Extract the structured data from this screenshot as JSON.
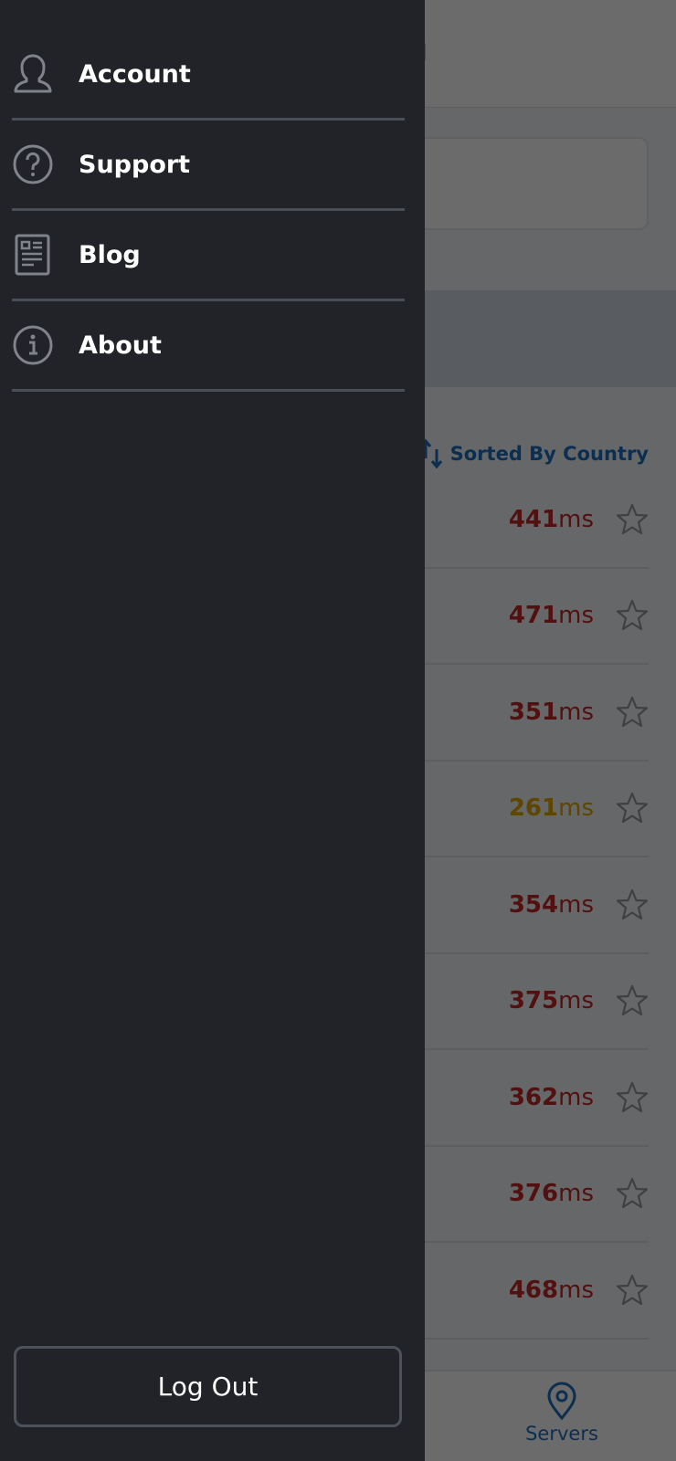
{
  "app": {
    "title_fragment": "n",
    "sort_label": "Sorted By Country",
    "servers": [
      {
        "latency": "441",
        "unit": "ms",
        "status": "red"
      },
      {
        "latency": "471",
        "unit": "ms",
        "status": "red"
      },
      {
        "latency": "351",
        "unit": "ms",
        "status": "red"
      },
      {
        "latency": "261",
        "unit": "ms",
        "status": "amber"
      },
      {
        "latency": "354",
        "unit": "ms",
        "status": "red"
      },
      {
        "latency": "375",
        "unit": "ms",
        "status": "red"
      },
      {
        "latency": "362",
        "unit": "ms",
        "status": "red"
      },
      {
        "latency": "376",
        "unit": "ms",
        "status": "red"
      },
      {
        "latency": "468",
        "unit": "ms",
        "status": "red"
      }
    ],
    "bottom_nav": {
      "servers_label": "Servers"
    }
  },
  "drawer": {
    "items": [
      {
        "label": "Account",
        "icon": "user-icon"
      },
      {
        "label": "Support",
        "icon": "help-circle-icon"
      },
      {
        "label": "Blog",
        "icon": "newspaper-icon"
      },
      {
        "label": "About",
        "icon": "info-icon"
      }
    ],
    "logout_label": "Log Out"
  },
  "colors": {
    "drawer_bg": "#212328",
    "divider": "#4a4e56",
    "icon_gray": "#80848a",
    "accent_blue": "#1d6fbf",
    "latency_red": "#c62828",
    "latency_amber": "#e0a800"
  }
}
